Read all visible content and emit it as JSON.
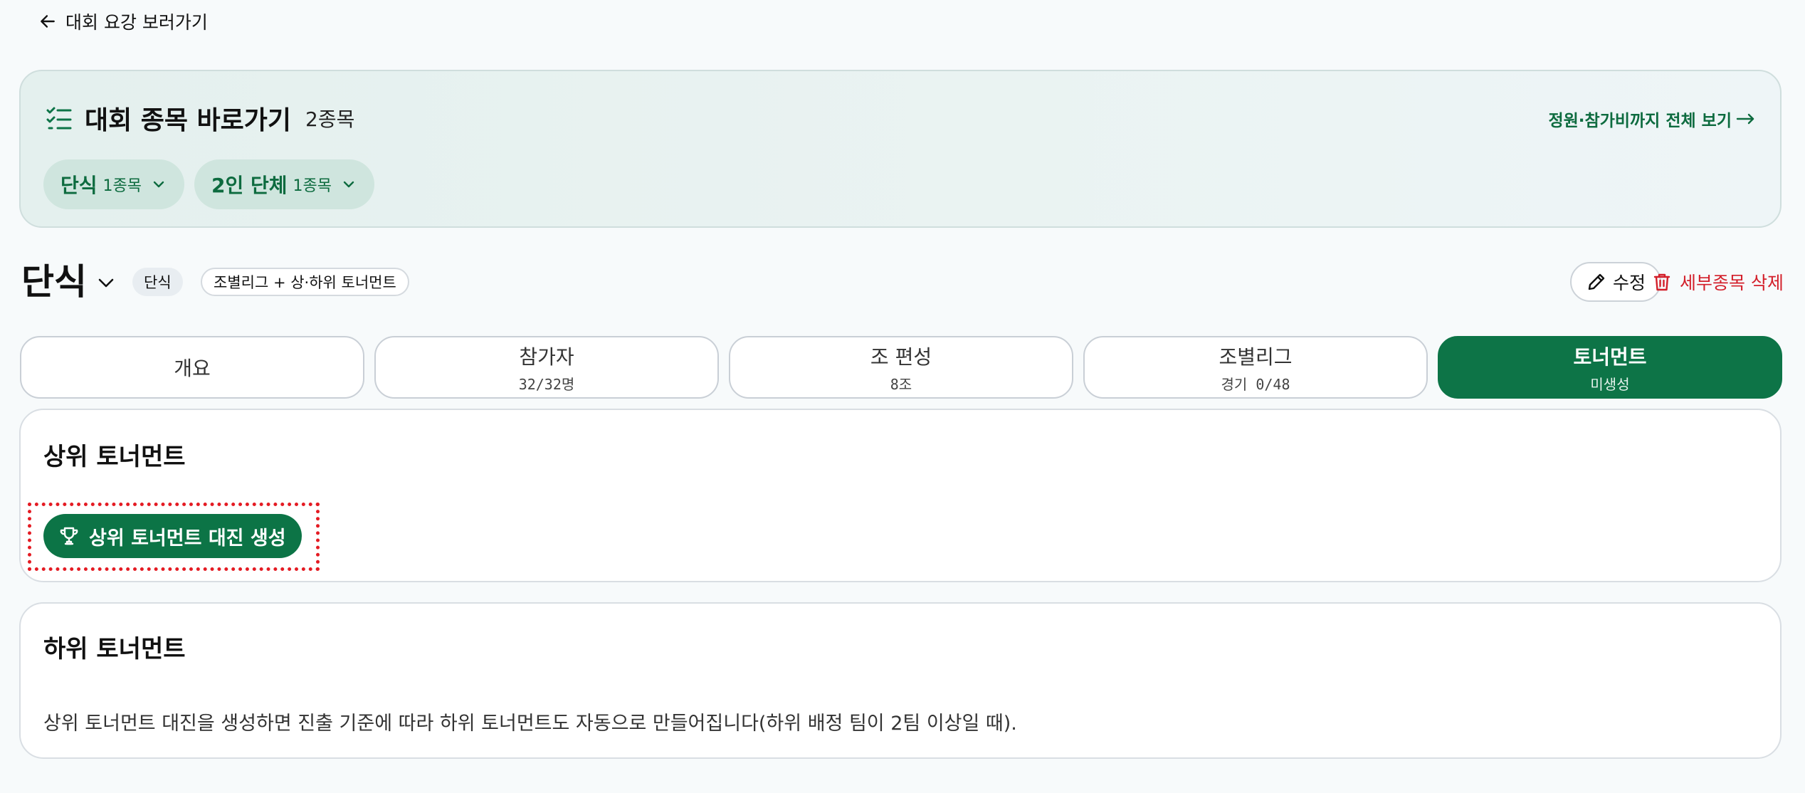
{
  "back_link": {
    "label": "대회 요강 보러가기"
  },
  "shortcut": {
    "title": "대회 종목 바로가기",
    "count": "2종목",
    "view_all": "정원·참가비까지 전체 보기",
    "chips": [
      {
        "name": "단식",
        "count": "1종목"
      },
      {
        "name": "2인 단체",
        "count": "1종목"
      }
    ]
  },
  "event": {
    "title": "단식",
    "type_tag": "단식",
    "format_tag": "조별리그 + 상·하위 토너먼트",
    "edit_label": "수정",
    "delete_label": "세부종목 삭제"
  },
  "tabs": [
    {
      "label": "개요",
      "sub": ""
    },
    {
      "label": "참가자",
      "sub": "32/32명"
    },
    {
      "label": "조 편성",
      "sub": "8조"
    },
    {
      "label": "조별리그",
      "sub": "경기 0/48"
    },
    {
      "label": "토너먼트",
      "sub": "미생성",
      "active": true
    }
  ],
  "upper": {
    "title": "상위 토너먼트",
    "generate_label": "상위 토너먼트 대진 생성"
  },
  "lower": {
    "title": "하위 토너먼트",
    "description": "상위 토너먼트 대진을 생성하면 진출 기준에 따라 하위 토너먼트도 자동으로 만들어집니다(하위 배정 팀이 2팀 이상일 때)."
  },
  "colors": {
    "brand_green": "#0d7447",
    "danger_red": "#d31f2a",
    "highlight_outline": "#e41b23"
  }
}
